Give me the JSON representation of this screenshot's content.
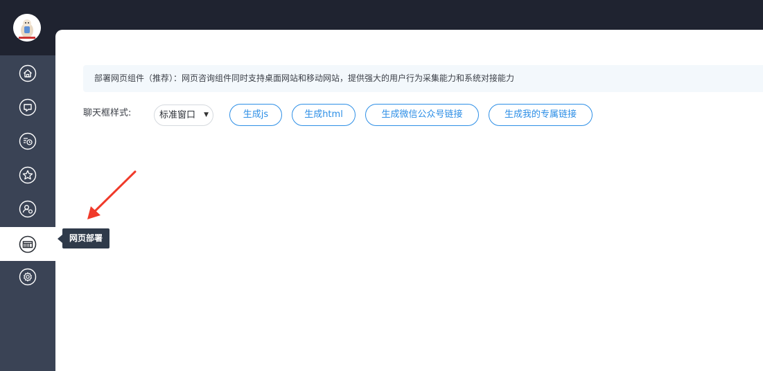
{
  "sidebar": {
    "items": [
      {
        "icon": "home-icon"
      },
      {
        "icon": "chat-icon"
      },
      {
        "icon": "history-icon"
      },
      {
        "icon": "star-icon"
      },
      {
        "icon": "user-settings-icon"
      },
      {
        "icon": "web-deploy-icon",
        "active": true
      },
      {
        "icon": "gear-icon"
      }
    ],
    "tooltip": "网页部署"
  },
  "notice": {
    "text": "部署网页组件（推荐）：网页咨询组件同时支持桌面网站和移动网站，提供强大的用户行为采集能力和系统对接能力"
  },
  "config": {
    "style_label": "聊天框样式:",
    "style_value": "标准窗口"
  },
  "buttons": {
    "gen_js": "生成js",
    "gen_html": "生成html",
    "gen_wechat": "生成微信公众号链接",
    "gen_link": "生成我的专属链接"
  },
  "colors": {
    "topbar": "#1f2330",
    "sidebar": "#3a4355",
    "accent": "#2c8ee6",
    "annotation": "#f03a2a"
  }
}
